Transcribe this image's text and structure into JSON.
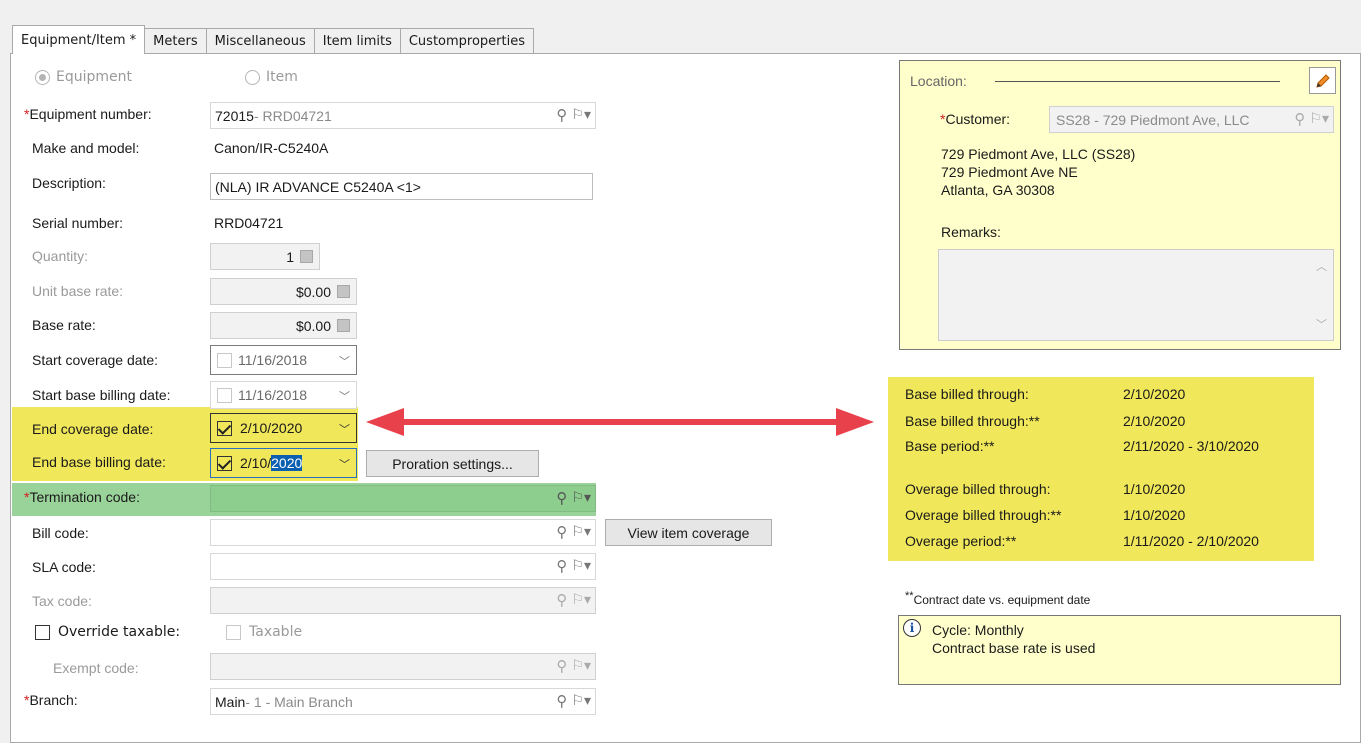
{
  "tabs": [
    "Equipment/Item *",
    "Meters",
    "Miscellaneous",
    "Item limits",
    "Customproperties"
  ],
  "type_radio": {
    "equipment": "Equipment",
    "item": "Item"
  },
  "form": {
    "equipment_number": {
      "label": "Equipment number:",
      "value_num": "72015",
      "value_rest": " - RRD04721"
    },
    "make_model": {
      "label": "Make and model:",
      "value": "Canon/IR-C5240A"
    },
    "description": {
      "label": "Description:",
      "value": "(NLA) IR ADVANCE C5240A <1>"
    },
    "serial": {
      "label": "Serial number:",
      "value": "RRD04721"
    },
    "quantity": {
      "label": "Quantity:",
      "value": "1"
    },
    "unit_base_rate": {
      "label": "Unit base rate:",
      "value": "$0.00"
    },
    "base_rate": {
      "label": "Base rate:",
      "value": "$0.00"
    },
    "start_coverage": {
      "label": "Start coverage date:",
      "value": "11/16/2018"
    },
    "start_billing": {
      "label": "Start base billing date:",
      "value": "11/16/2018"
    },
    "end_coverage": {
      "label": "End coverage date:",
      "value": "2/10/2020"
    },
    "end_billing": {
      "label": "End base billing date:",
      "value_prefix": "2/10/",
      "value_selected": "2020"
    },
    "proration_button": "Proration settings...",
    "termination": {
      "label": "Termination code:",
      "value": ""
    },
    "bill_code": {
      "label": "Bill code:",
      "value": ""
    },
    "view_coverage_button": "View item coverage",
    "sla_code": {
      "label": "SLA code:",
      "value": ""
    },
    "tax_code": {
      "label": "Tax code:",
      "value": ""
    },
    "override_taxable": "Override taxable:",
    "taxable": "Taxable",
    "exempt_code": {
      "label": "Exempt code:",
      "value": ""
    },
    "branch": {
      "label": "Branch:",
      "value_main": "Main",
      "value_rest": " - 1 - Main Branch"
    }
  },
  "location": {
    "title": "Location:",
    "customer_label": "Customer:",
    "customer_value": "SS28 - 729 Piedmont Ave, LLC",
    "address": [
      "729 Piedmont Ave, LLC  (SS28)",
      "729 Piedmont Ave NE",
      "Atlanta, GA 30308"
    ],
    "remarks_label": "Remarks:",
    "remarks_value": ""
  },
  "billing_summary": [
    {
      "label": "Base billed through:",
      "value": "2/10/2020"
    },
    {
      "label": "Base billed through:**",
      "value": "2/10/2020"
    },
    {
      "label": "Base period:**",
      "value": "2/11/2020 - 3/10/2020"
    },
    {
      "label": "Overage billed through:",
      "value": "1/10/2020"
    },
    {
      "label": "Overage billed through:**",
      "value": "1/10/2020"
    },
    {
      "label": "Overage period:**",
      "value": "1/11/2020 - 2/10/2020"
    }
  ],
  "footnote": {
    "stars": "**",
    "text": "Contract date vs. equipment date"
  },
  "info": {
    "line1": "Cycle: Monthly",
    "line2": "Contract base rate is used"
  },
  "colors": {
    "highlight_yellow": "#f0e75a",
    "highlight_green": "#5cb85c",
    "arrow": "#e8414b",
    "required": "#d02020",
    "info_bg": "#ffffcc"
  },
  "icons": [
    "search-icon",
    "flag-dropdown-icon",
    "calendar-icon",
    "chevron-down-icon",
    "pencil-icon",
    "info-icon"
  ]
}
